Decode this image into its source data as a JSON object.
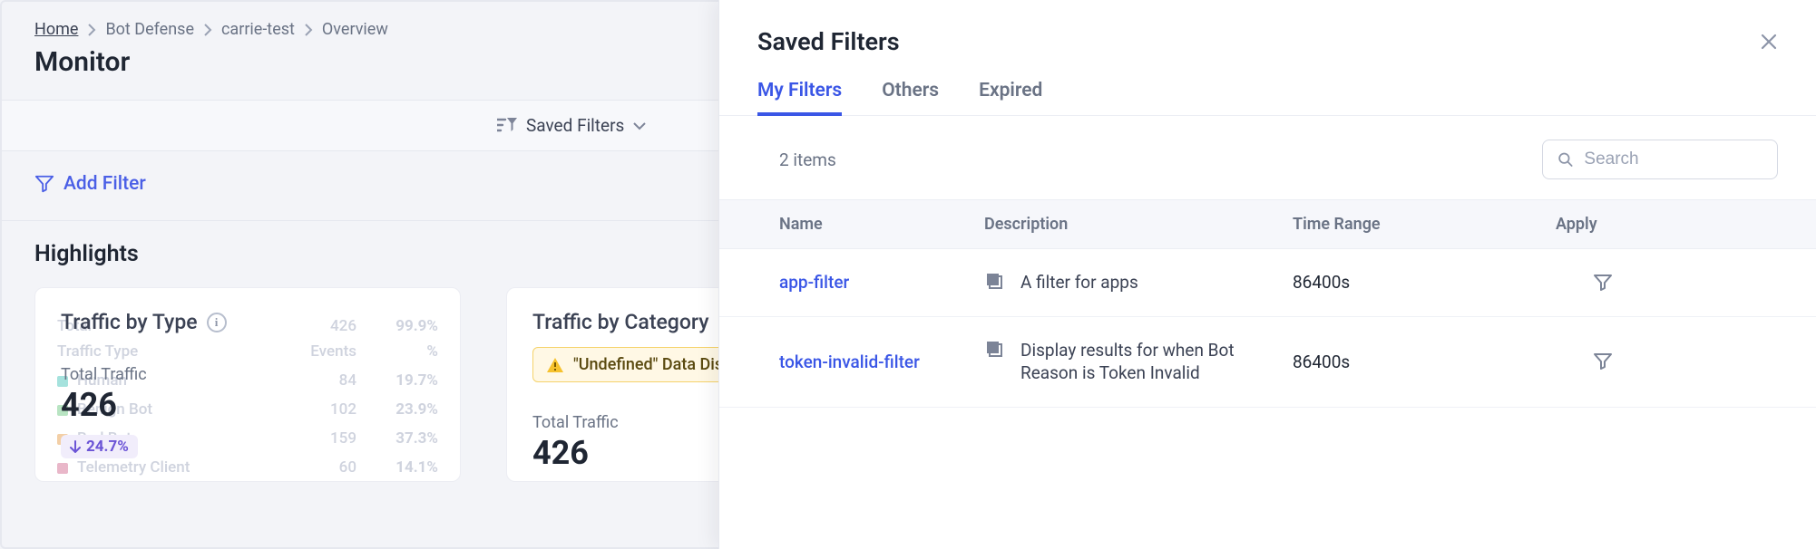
{
  "breadcrumb": {
    "items": [
      {
        "label": "Home",
        "link": true
      },
      {
        "label": "Bot Defense",
        "link": false
      },
      {
        "label": "carrie-test",
        "link": false
      },
      {
        "label": "Overview",
        "link": false
      }
    ]
  },
  "page_title": "Monitor",
  "filter_bar": {
    "saved_filters_label": "Saved Filters"
  },
  "add_filter_label": "Add Filter",
  "highlights_title": "Highlights",
  "cards": {
    "traffic_by_type": {
      "title": "Traffic by Type",
      "total_label": "Total Traffic",
      "total_value": "426",
      "delta": "24.7%",
      "ghost": {
        "headers": [
          "Traffic Type",
          "Events",
          "%"
        ],
        "total_row": [
          "Total",
          "426",
          "99.9%"
        ],
        "rows": [
          [
            "Human",
            "84",
            "19.7%"
          ],
          [
            "Benign Bot",
            "102",
            "23.9%"
          ],
          [
            "Bad Bot",
            "159",
            "37.3%"
          ],
          [
            "Telemetry Client",
            "60",
            "14.1%"
          ]
        ]
      }
    },
    "traffic_by_category": {
      "title": "Traffic by Category",
      "warn": "\"Undefined\" Data Dis",
      "total_label": "Total Traffic",
      "total_value": "426"
    }
  },
  "panel": {
    "title": "Saved Filters",
    "tabs": [
      {
        "label": "My Filters",
        "active": true
      },
      {
        "label": "Others",
        "active": false
      },
      {
        "label": "Expired",
        "active": false
      }
    ],
    "item_count": "2 items",
    "search_placeholder": "Search",
    "columns": {
      "name": "Name",
      "description": "Description",
      "time_range": "Time Range",
      "apply": "Apply"
    },
    "rows": [
      {
        "name": "app-filter",
        "description": "A filter for apps",
        "time_range": "86400s"
      },
      {
        "name": "token-invalid-filter",
        "description": "Display results for when Bot Reason is Token Invalid",
        "time_range": "86400s"
      }
    ]
  }
}
